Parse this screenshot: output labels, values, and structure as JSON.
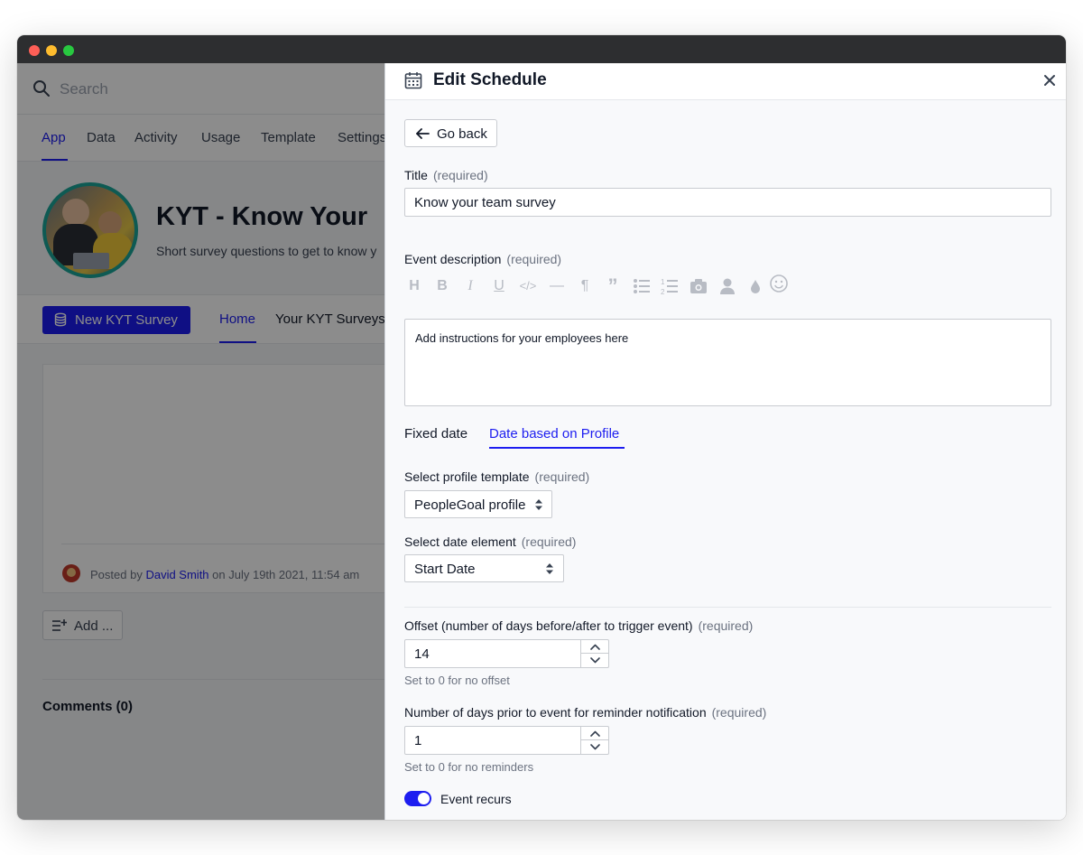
{
  "background_app": {
    "search": {
      "placeholder": "Search"
    },
    "nav": [
      {
        "label": "App",
        "active": true
      },
      {
        "label": "Data"
      },
      {
        "label": "Activity"
      },
      {
        "label": "Usage"
      },
      {
        "label": "Template"
      },
      {
        "label": "Settings"
      }
    ],
    "hero": {
      "title": "KYT - Know Your",
      "subtitle": "Short survey questions to get to know y"
    },
    "new_button_label": "New KYT Survey",
    "subnav": [
      {
        "label": "Home",
        "active": true
      },
      {
        "label": "Your KYT Surveys"
      }
    ],
    "post": {
      "prefix": "Posted by",
      "author": "David Smith",
      "suffix": "on July 19th 2021, 11:54 am"
    },
    "add_button_label": "Add ...",
    "comments_title": "Comments (0)"
  },
  "drawer": {
    "title": "Edit Schedule",
    "back_label": "Go back",
    "title_field": {
      "label": "Title",
      "required": "(required)",
      "value": "Know your team survey"
    },
    "description_field": {
      "label": "Event description",
      "required": "(required)",
      "value": "Add instructions for your employees here",
      "toolbar": [
        "heading-icon",
        "bold-icon",
        "italic-icon",
        "underline-icon",
        "code-icon",
        "horizontal-rule-icon",
        "paragraph-icon",
        "quote-icon",
        "bulleted-list-icon",
        "numbered-list-icon",
        "image-icon",
        "person-icon",
        "color-drop-icon",
        "emoji-icon"
      ]
    },
    "tabs": [
      {
        "label": "Fixed date"
      },
      {
        "label": "Date based on Profile",
        "active": true
      }
    ],
    "profile_template": {
      "label": "Select profile template",
      "required": "(required)",
      "value": "PeopleGoal profile"
    },
    "date_element": {
      "label": "Select date element",
      "required": "(required)",
      "value": "Start Date"
    },
    "offset": {
      "label": "Offset (number of days before/after to trigger event)",
      "required": "(required)",
      "value": "14",
      "hint": "Set to 0 for no offset"
    },
    "reminder": {
      "label": "Number of days prior to event for reminder notification",
      "required": "(required)",
      "value": "1",
      "hint": "Set to 0 for no reminders"
    },
    "recurs": {
      "label": "Event recurs",
      "on": true
    }
  },
  "colors": {
    "accent": "#1d1df0",
    "avatar_ring": "#1aa597",
    "titlebar": "#2d2e30"
  }
}
